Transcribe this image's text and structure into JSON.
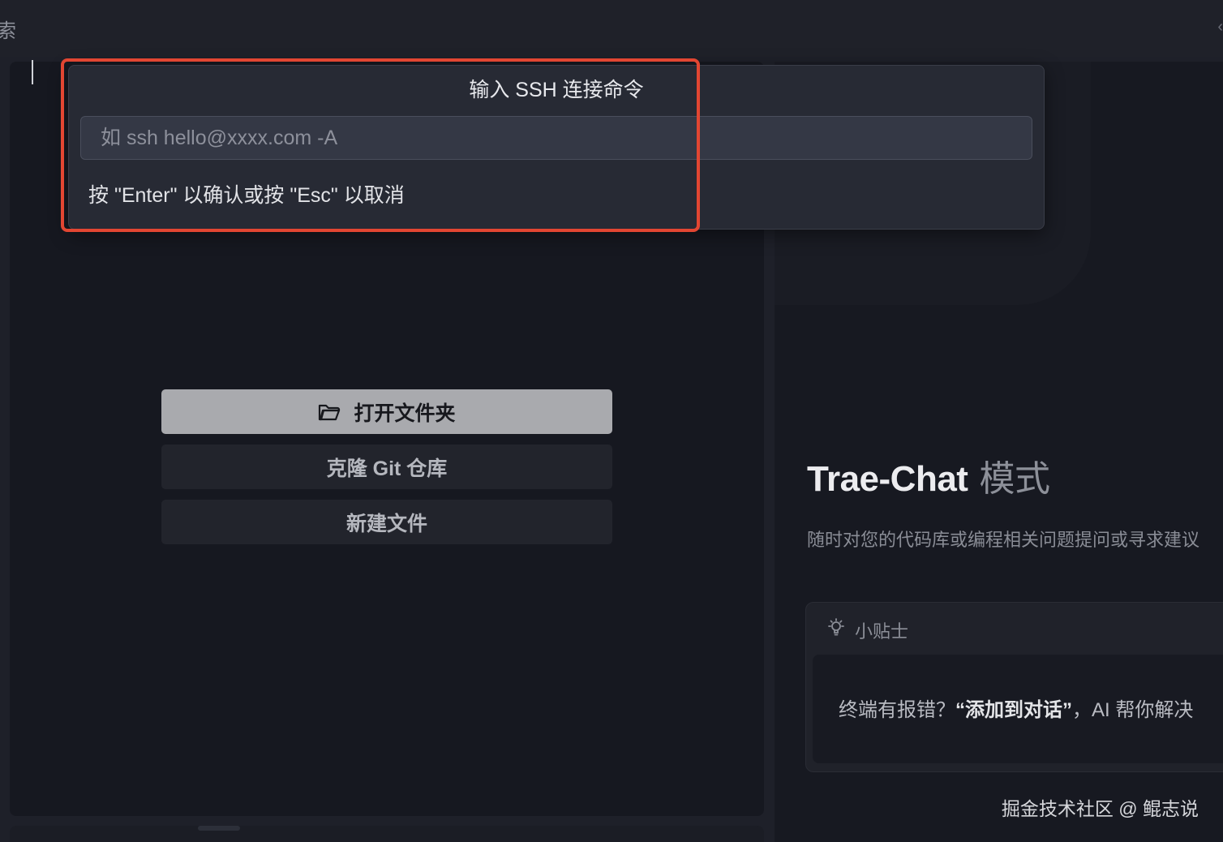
{
  "topbar": {
    "search_label": "索",
    "right_icon": "chevron-left-icon"
  },
  "welcome": {
    "open_folder_label": "打开文件夹",
    "clone_git_label": "克隆 Git 仓库",
    "new_file_label": "新建文件",
    "open_folder_icon": "folder-icon"
  },
  "ssh_dialog": {
    "title": "输入 SSH 连接命令",
    "placeholder": "如 ssh hello@xxxx.com -A",
    "value": "",
    "hint": "按 \"Enter\" 以确认或按 \"Esc\" 以取消"
  },
  "ai_panel": {
    "title": "Trae-Chat",
    "title_mode": "模式",
    "subtitle": "随时对您的代码库或编程相关问题提问或寻求建议",
    "tips": {
      "header": "小贴士",
      "icon": "lightbulb-icon",
      "text_prefix": "终端有报错？",
      "text_bold": "“添加到对话”",
      "text_suffix": "，AI 帮你解决"
    }
  },
  "watermark": "掘金技术社区 @ 鲲志说",
  "colors": {
    "background": "#1e2029",
    "primary_button": "#a9aaae",
    "highlight": "#e24632"
  }
}
